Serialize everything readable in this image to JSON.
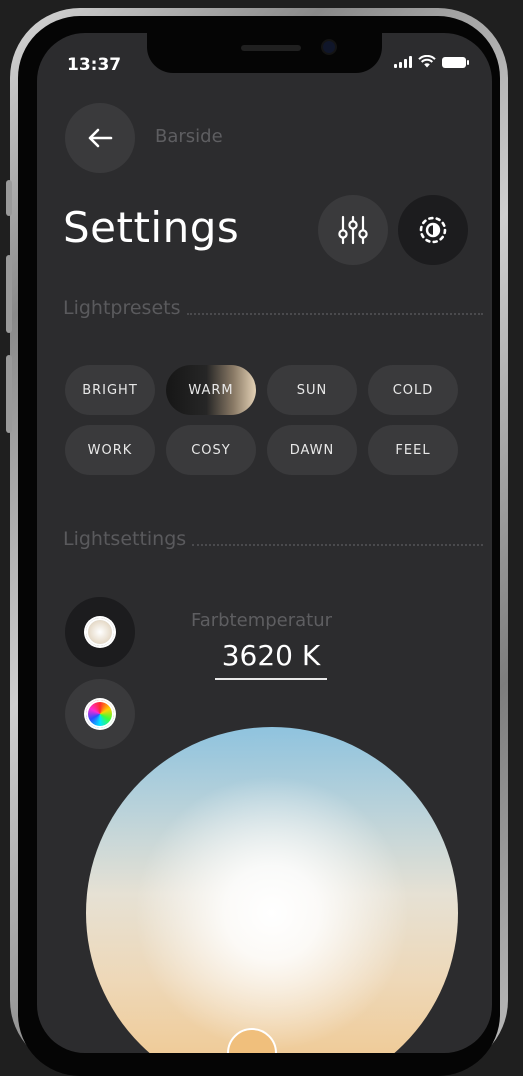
{
  "status_bar": {
    "time": "13:37"
  },
  "header": {
    "breadcrumb": "Barside",
    "title": "Settings"
  },
  "sections": {
    "presets_label": "Lightpresets",
    "settings_label": "Lightsettings"
  },
  "presets": [
    {
      "label": "BRIGHT",
      "active": false
    },
    {
      "label": "WARM",
      "active": true
    },
    {
      "label": "SUN",
      "active": false
    },
    {
      "label": "COLD",
      "active": false
    },
    {
      "label": "WORK",
      "active": false
    },
    {
      "label": "COSY",
      "active": false
    },
    {
      "label": "DAWN",
      "active": false
    },
    {
      "label": "FEEL",
      "active": false
    }
  ],
  "light_settings": {
    "temperature_label": "Farbtemperatur",
    "temperature_value": "3620 K"
  },
  "icons": {
    "back": "arrow-left-icon",
    "sliders": "sliders-icon",
    "mode": "brightness-icon",
    "temperature": "color-temperature-icon",
    "color": "color-wheel-icon"
  },
  "colors": {
    "screen_bg": "#2c2c2e",
    "button_bg": "#3a3a3c",
    "dark_button_bg": "#1c1c1e",
    "muted_text": "#5e5e61",
    "warm_accent": "#e4d2b6"
  }
}
